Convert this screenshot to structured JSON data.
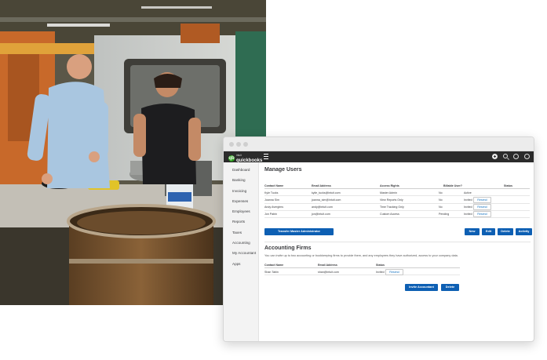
{
  "window": {
    "brand_prefix": "intuit",
    "brand_name": "quickbooks",
    "logo_glyph": "qb",
    "colors": {
      "accent_blue": "#0d5fb3",
      "link_blue": "#0d6ebf",
      "brand_green": "#2ca01c",
      "topbar": "#2b2b2b"
    }
  },
  "sidebar": {
    "items": [
      {
        "label": "Dashboard"
      },
      {
        "label": "Banking"
      },
      {
        "label": "Invoicing"
      },
      {
        "label": "Expenses"
      },
      {
        "label": "Employees"
      },
      {
        "label": "Reports"
      },
      {
        "label": "Taxes"
      },
      {
        "label": "Accounting"
      },
      {
        "label": "My Accountant"
      },
      {
        "label": "Apps"
      }
    ]
  },
  "topbar_icons": [
    "plus-icon",
    "search-icon",
    "gear-icon",
    "help-icon"
  ],
  "manage_users": {
    "title": "Manage Users",
    "columns": [
      "Contact Name",
      "Email Address",
      "Access Rights",
      "Billable User?",
      "Status"
    ],
    "rows": [
      {
        "name": "Kyle Tucks",
        "email": "kylie_tucks@intuit.com",
        "rights": "Master Admin",
        "billable": "No",
        "status": "Active",
        "action": ""
      },
      {
        "name": "Joanna Sim",
        "email": "joanna_sim@intuit.com",
        "rights": "View Reports Only",
        "billable": "No",
        "status": "Invited",
        "action": "Resend"
      },
      {
        "name": "Andy Avergirns",
        "email": "andy@intuit.com",
        "rights": "Time Tracking Only",
        "billable": "No",
        "status": "Invited",
        "action": "Resend"
      },
      {
        "name": "Jon Pabin",
        "email": "jon@intuit.com",
        "rights": "Custom Access",
        "billable": "Pending",
        "status": "Invited",
        "action": "Resend"
      }
    ],
    "transfer_label": "Transfer Master Administrator",
    "actions": [
      "New",
      "Edit",
      "Delete",
      "Activity"
    ]
  },
  "accounting_firms": {
    "title": "Accounting Firms",
    "note": "You can invite up to two accounting or bookkeeping firms to provide them, and any employees they have authorized, access to your company data.",
    "columns": [
      "Contact Name",
      "Email Address",
      "Status"
    ],
    "rows": [
      {
        "name": "Shan Tabin",
        "email": "shan@intuit.com",
        "status": "Invited",
        "action": "Resend"
      }
    ],
    "invite_label": "Invite Accountant",
    "delete_label": "Delete"
  }
}
